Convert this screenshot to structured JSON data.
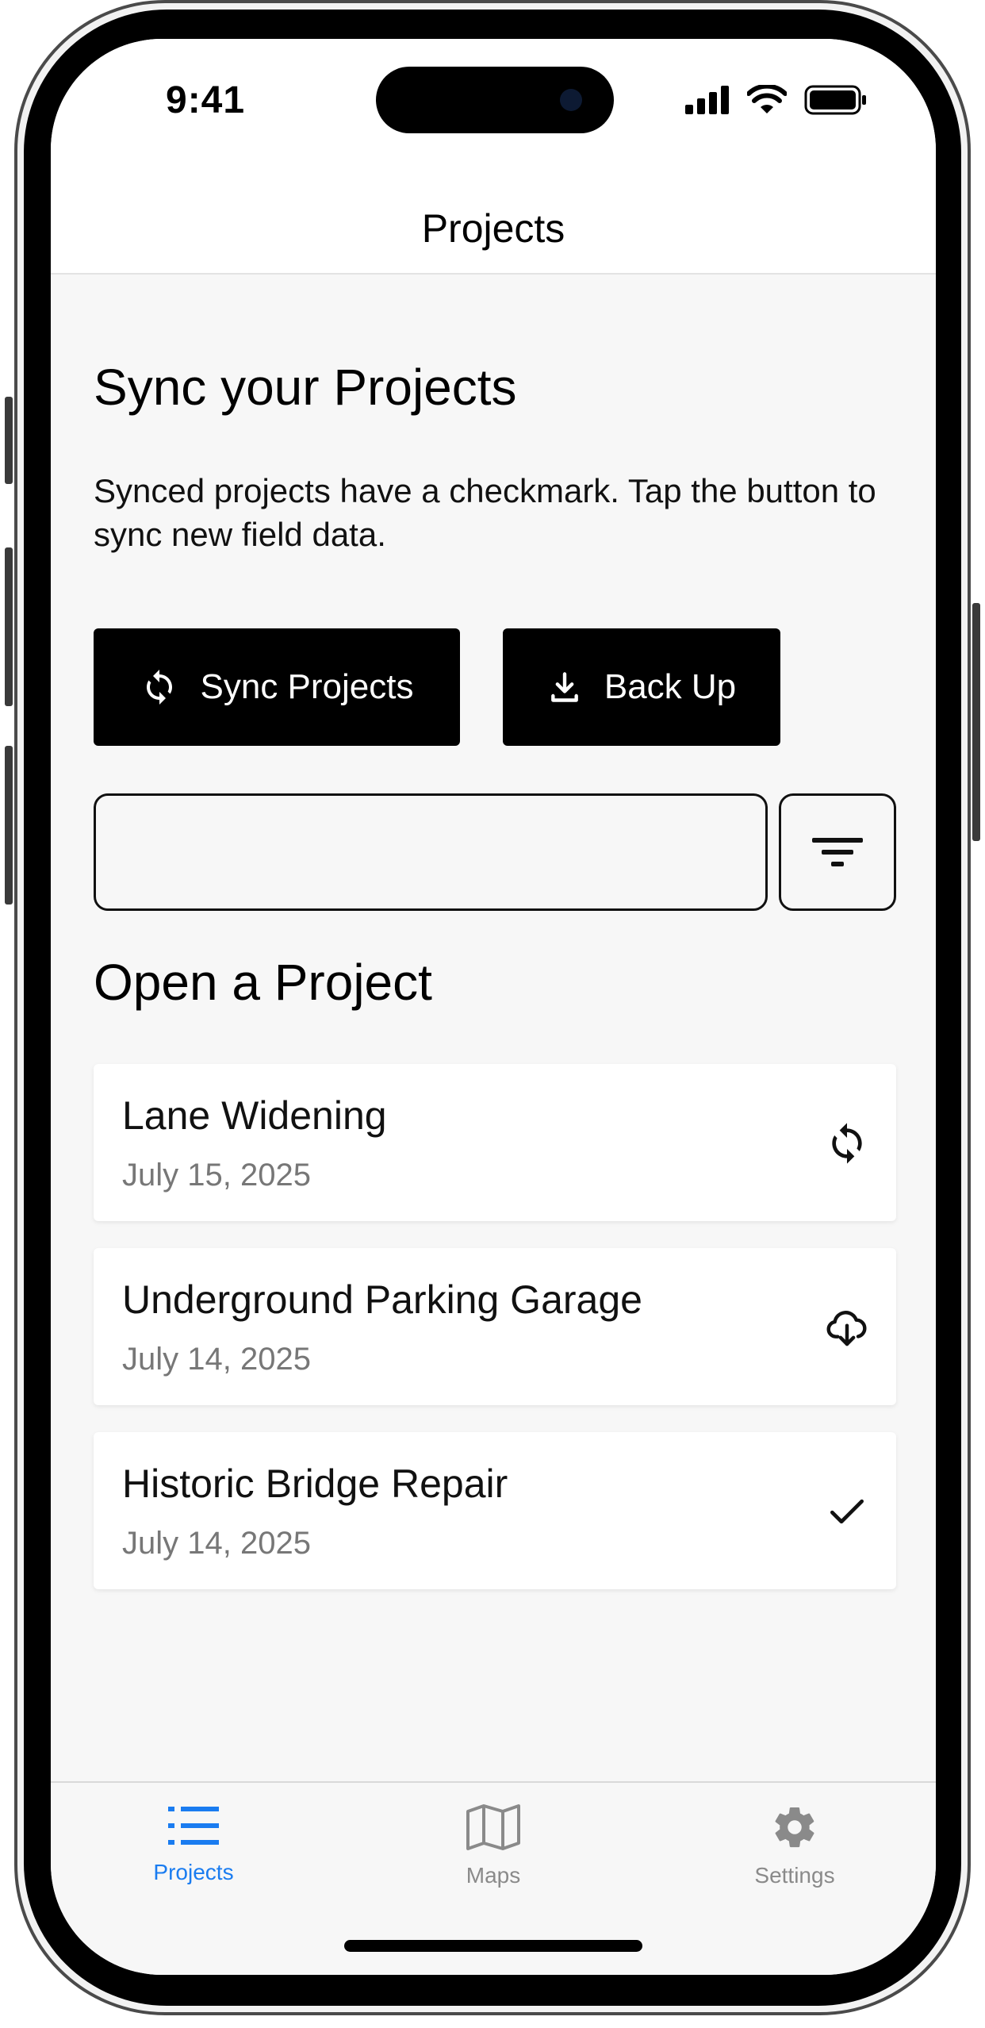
{
  "status": {
    "time": "9:41"
  },
  "header": {
    "title": "Projects"
  },
  "sync_section": {
    "heading": "Sync your Projects",
    "description": "Synced projects have a checkmark. Tap the button to sync new field data.",
    "sync_button_label": "Sync Projects",
    "backup_button_label": "Back Up"
  },
  "search": {
    "value": "",
    "placeholder": ""
  },
  "projects_section": {
    "heading": "Open a Project",
    "items": [
      {
        "title": "Lane Widening",
        "date": "July 15, 2025",
        "status_icon": "sync-icon"
      },
      {
        "title": "Underground Parking Garage",
        "date": "July 14, 2025",
        "status_icon": "cloud-download-icon"
      },
      {
        "title": "Historic Bridge Repair",
        "date": "July 14, 2025",
        "status_icon": "checkmark-icon"
      }
    ]
  },
  "tab_bar": {
    "tabs": [
      {
        "label": "Projects",
        "icon": "list-icon",
        "active": true
      },
      {
        "label": "Maps",
        "icon": "map-icon",
        "active": false
      },
      {
        "label": "Settings",
        "icon": "gear-icon",
        "active": false
      }
    ]
  },
  "colors": {
    "accent": "#1a7cf0",
    "primary_button": "#000000",
    "inactive_tab": "#8a8a8a"
  }
}
